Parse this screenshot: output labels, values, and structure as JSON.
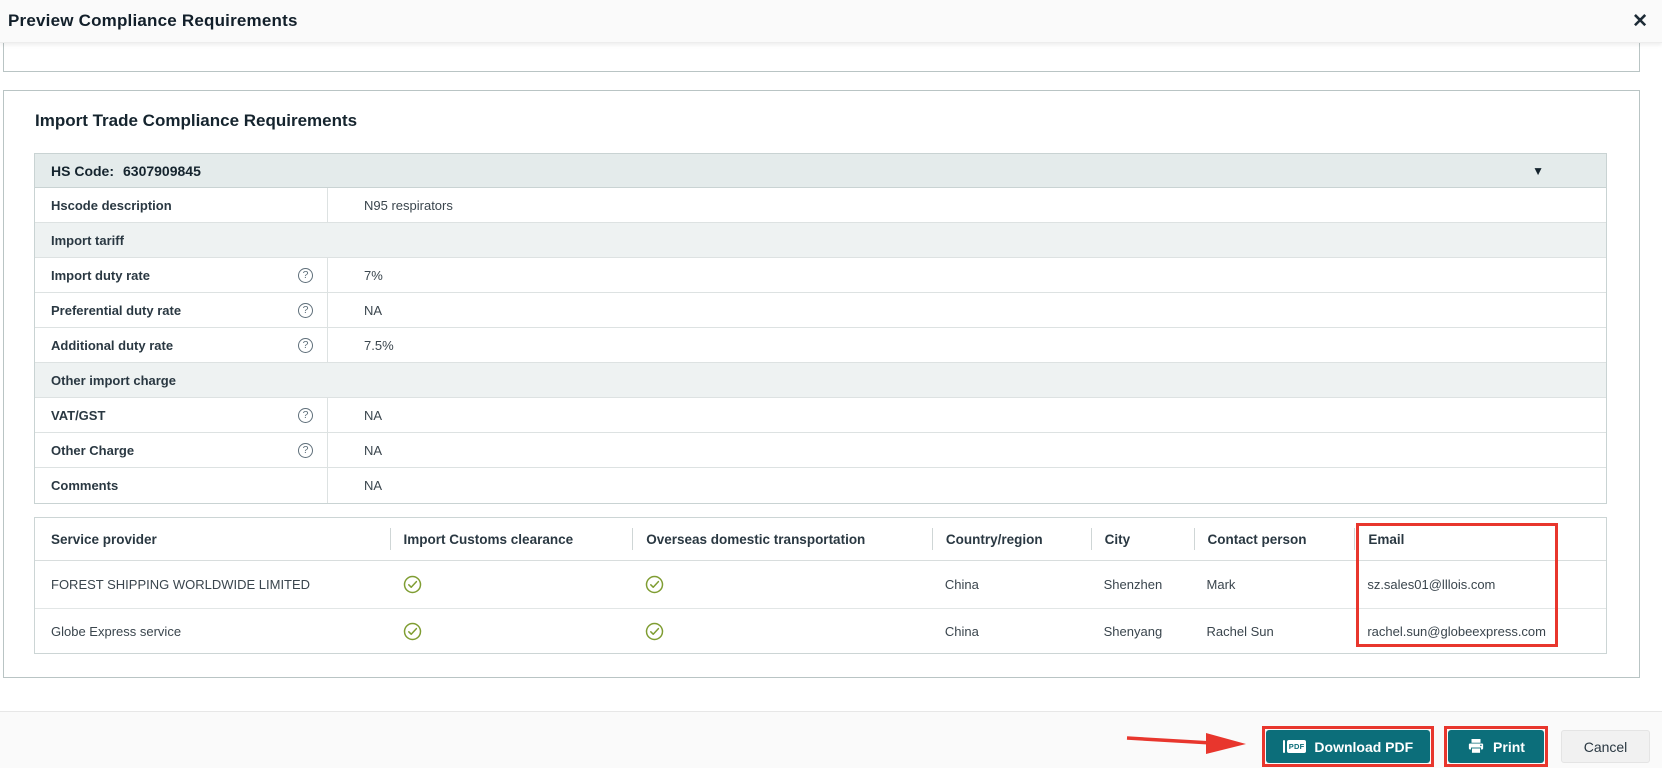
{
  "modal": {
    "title": "Preview Compliance Requirements"
  },
  "icons": {
    "close_glyph": "✕",
    "collapse_glyph": "▼",
    "help_glyph": "?"
  },
  "section": {
    "heading": "Import Trade Compliance Requirements"
  },
  "hs_table": {
    "hs_code_label": "HS Code:",
    "hs_code_value": "6307909845",
    "rows": [
      {
        "type": "data",
        "label": "Hscode description",
        "value": "N95 respirators",
        "help": false
      },
      {
        "type": "section",
        "label": "Import tariff"
      },
      {
        "type": "data",
        "label": "Import duty rate",
        "value": "7%",
        "help": true
      },
      {
        "type": "data",
        "label": "Preferential duty rate",
        "value": "NA",
        "help": true
      },
      {
        "type": "data",
        "label": "Additional duty rate",
        "value": "7.5%",
        "help": true
      },
      {
        "type": "section",
        "label": "Other import charge"
      },
      {
        "type": "data",
        "label": "VAT/GST",
        "value": "NA",
        "help": true
      },
      {
        "type": "data",
        "label": "Other Charge",
        "value": "NA",
        "help": true
      },
      {
        "type": "data",
        "label": "Comments",
        "value": "NA",
        "help": false
      }
    ]
  },
  "providers_table": {
    "columns": [
      "Service provider",
      "Import Customs clearance",
      "Overseas domestic transportation",
      "Country/region",
      "City",
      "Contact person",
      "Email"
    ],
    "rows": [
      {
        "service_provider": "FOREST SHIPPING WORLDWIDE LIMITED",
        "import_customs_clearance": true,
        "overseas_domestic_transportation": true,
        "country": "China",
        "city": "Shenzhen",
        "contact": "Mark",
        "email": "sz.sales01@lllois.com"
      },
      {
        "service_provider": "Globe Express service",
        "import_customs_clearance": true,
        "overseas_domestic_transportation": true,
        "country": "China",
        "city": "Shenyang",
        "contact": "Rachel Sun",
        "email": "rachel.sun@globeexpress.com"
      }
    ]
  },
  "footer": {
    "download_pdf_label": "Download PDF",
    "pdf_icon_text": "PDF",
    "print_label": "Print",
    "cancel_label": "Cancel"
  },
  "colors": {
    "teal": "#0c6e7a",
    "annotation_red": "#e8362d",
    "check_green": "#7f9d32",
    "hs_bar_bg": "#e4ebeb",
    "section_row_bg": "#eef2f2"
  }
}
